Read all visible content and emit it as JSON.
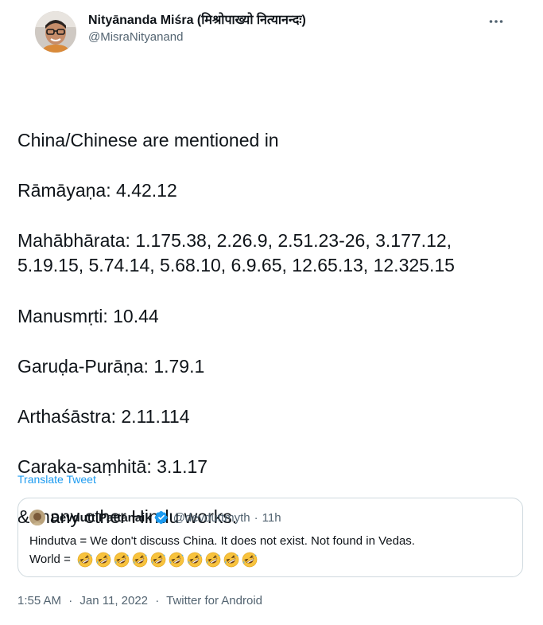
{
  "author": {
    "display_name": "Nityānanda Miśra (मिश्रोपाख्यो नित्यानन्दः)",
    "handle": "@MisraNityanand",
    "avatar_icon": "profile-photo"
  },
  "more_icon": "ellipsis-icon",
  "tweet": {
    "lines": [
      "China/Chinese are mentioned in",
      "Rāmāyaṇa: 4.42.12",
      "Mahābhārata: 1.175.38, 2.26.9, 2.51.23-26, 3.177.12,",
      "5.19.15, 5.74.14, 5.68.10, 6.9.65, 12.65.13, 12.325.15",
      "Manusmṛti: 10.44",
      "Garuḍa-Purāṇa: 1.79.1",
      "Arthaśāstra: 2.11.114",
      "Caraka-saṃhitā: 3.1.17",
      "& many other Hindu works."
    ],
    "translate_label": "Translate Tweet"
  },
  "quoted_tweet": {
    "display_name": "Devdutt Pattanaik",
    "handle": "@devduttmyth",
    "separator": "·",
    "time": "11h",
    "verified": true,
    "text_line1": "Hindutva = We don't discuss China. It does not exist. Not found in Vedas.",
    "text_line2": "World =",
    "emoji_count": 10,
    "emoji_name": "rolling-on-floor-laughing"
  },
  "meta": {
    "time": "1:55 AM",
    "separator": "·",
    "date": "Jan 11, 2022",
    "source": "Twitter for Android"
  },
  "colors": {
    "text": "#0f1419",
    "secondary": "#536471",
    "link": "#1d9bf0",
    "border": "#cfd9de"
  }
}
